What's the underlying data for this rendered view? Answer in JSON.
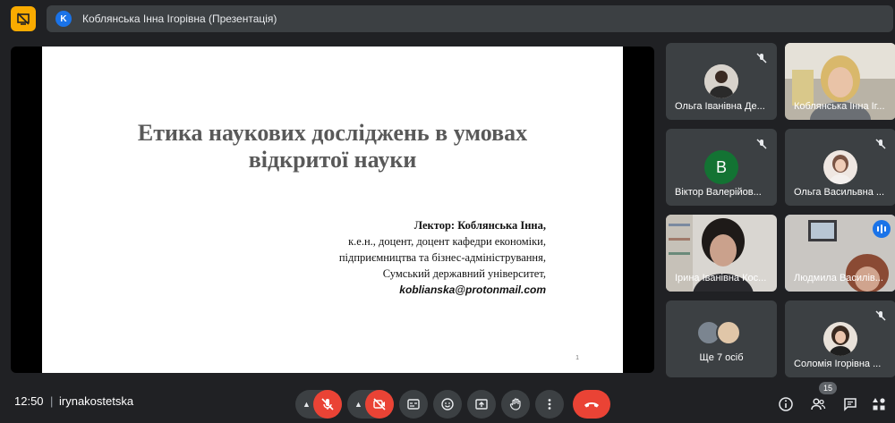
{
  "header": {
    "presenter_initial": "K",
    "title": "Коблянська Інна Ігорівна (Презентація)"
  },
  "slide": {
    "title_line1": "Етика наукових досліджень в умовах",
    "title_line2": "відкритої науки",
    "lecturer": "Лектор: Коблянська Інна,",
    "line1": "к.е.н., доцент, доцент кафедри економіки,",
    "line2": "підприємництва та бізнес-адміністрування,",
    "line3": "Сумський державний університет,",
    "email": "koblianska@protonmail.com",
    "page_number": "1"
  },
  "participants": [
    {
      "name": "Ольга Іванівна Де...",
      "muted": true
    },
    {
      "name": "Коблянська Інна Іг...",
      "muted": false
    },
    {
      "name": "Віктор Валерійов...",
      "initial": "B",
      "muted": true
    },
    {
      "name": "Ольга Васильвна ...",
      "muted": true
    },
    {
      "name": "Ірина Іванівна Кос...",
      "muted": false
    },
    {
      "name": "Людмила Василів...",
      "muted": false,
      "speaking": true
    },
    {
      "name": "Ще 7 осіб"
    },
    {
      "name": "Соломія Ігорівна ...",
      "muted": true
    }
  ],
  "footer": {
    "time": "12:50",
    "separator": "|",
    "meeting_code": "irynakostetska",
    "participant_count": "15"
  },
  "colors": {
    "background": "#202124",
    "tile": "#3c4043",
    "hangup": "#ea4335",
    "accent": "#1a73e8",
    "presenting_toggle": "#f9ab00"
  }
}
